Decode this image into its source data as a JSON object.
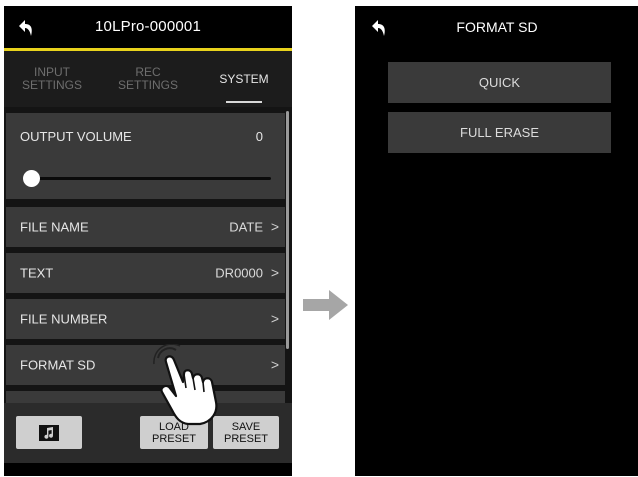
{
  "left_screen": {
    "title": "10LPro-000001",
    "tabs": [
      {
        "label": "INPUT\nSETTINGS",
        "active": false
      },
      {
        "label": "REC\nSETTINGS",
        "active": false
      },
      {
        "label": "SYSTEM",
        "active": true
      }
    ],
    "output_volume": {
      "label": "OUTPUT VOLUME",
      "value": "0"
    },
    "items": [
      {
        "label": "FILE NAME",
        "value": "DATE"
      },
      {
        "label": "TEXT",
        "value": "DR0000"
      },
      {
        "label": "FILE NUMBER",
        "value": ""
      },
      {
        "label": "FORMAT SD",
        "value": ""
      }
    ],
    "chevron": ">",
    "bottom": {
      "load_preset": "LOAD\nPRESET",
      "save_preset": "SAVE\nPRESET"
    }
  },
  "right_screen": {
    "title": "FORMAT SD",
    "buttons": [
      "QUICK",
      "FULL ERASE"
    ]
  },
  "colors": {
    "accent_yellow": "#e8d21c",
    "background": "#000000",
    "item_bg": "#3a3a3a"
  },
  "icons": {
    "back": "back-arrow-icon",
    "music": "music-note-icon",
    "transition": "right-arrow-icon",
    "tap": "tapping-hand-icon"
  }
}
